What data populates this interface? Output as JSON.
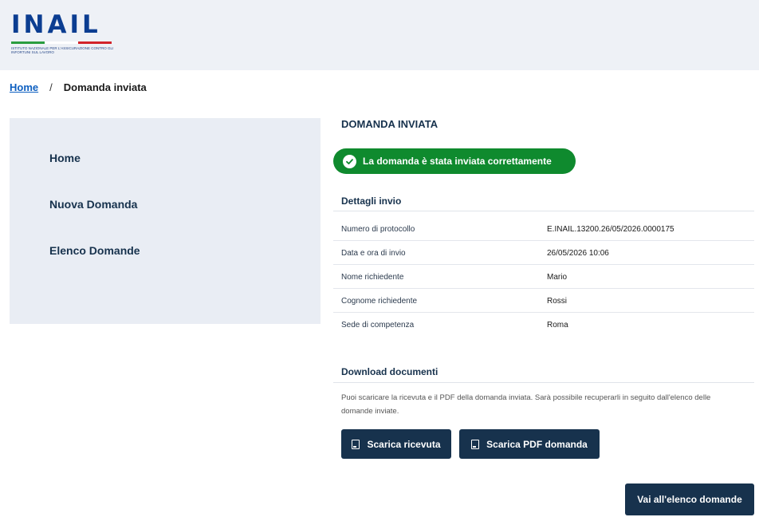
{
  "header": {
    "logo_text": "INAIL",
    "logo_subtitle": "ISTITUTO NAZIONALE PER L'ASSICURAZIONE CONTRO GLI INFORTUNI SUL LAVORO",
    "flag_colors": [
      "#2a9d3f",
      "#ffffff",
      "#d2232a"
    ]
  },
  "breadcrumb": {
    "home": "Home",
    "separator": "/",
    "current": "Domanda inviata"
  },
  "sidebar": {
    "items": [
      {
        "label": "Home"
      },
      {
        "label": "Nuova Domanda"
      },
      {
        "label": "Elenco Domande"
      }
    ]
  },
  "main": {
    "title": "DOMANDA INVIATA",
    "success_message": "La domanda è stata inviata correttamente",
    "details_title": "Dettagli invio",
    "details": [
      {
        "label": "Numero di protocollo",
        "value": "E.INAIL.13200.26/05/2026.0000175"
      },
      {
        "label": "Data e ora di invio",
        "value": "26/05/2026 10:06"
      },
      {
        "label": "Nome richiedente",
        "value": "Mario"
      },
      {
        "label": "Cognome richiedente",
        "value": "Rossi"
      },
      {
        "label": "Sede di competenza",
        "value": "Roma"
      }
    ],
    "download_title": "Download documenti",
    "download_description": "Puoi scaricare la ricevuta e il PDF della domanda inviata. Sarà possibile recuperarli in seguito dall'elenco delle domande inviate.",
    "buttons": {
      "receipt": "Scarica ricevuta",
      "pdf": "Scarica PDF domanda",
      "list": "Vai all'elenco domande"
    }
  },
  "colors": {
    "primary": "#17324d",
    "success": "#0f8a2e",
    "link": "#0d5fc0",
    "sidebar_bg": "#e9edf4"
  }
}
